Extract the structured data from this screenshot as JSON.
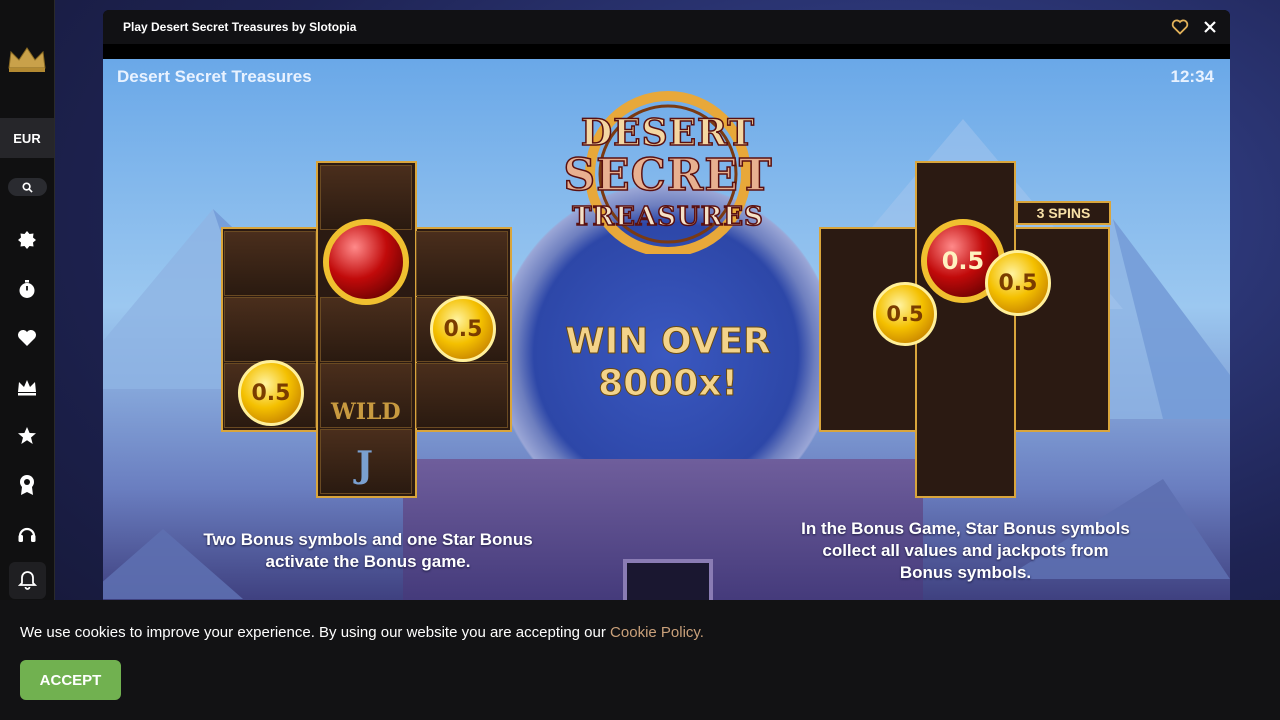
{
  "sidebar": {
    "logo_icon": "crown-logo-icon",
    "currency": "EUR",
    "icons": [
      "search-icon",
      "new-badge-icon",
      "stopwatch-icon",
      "heart-icon",
      "crown-icon",
      "star-icon",
      "award-icon",
      "headset-icon",
      "bell-icon"
    ]
  },
  "window": {
    "title": "Play Desert Secret Treasures by Slotopia"
  },
  "game": {
    "hud_title": "Desert Secret Treasures",
    "clock": "12:34",
    "logo_lines": [
      "DESERT",
      "SECRET",
      "TREASURES"
    ],
    "win_line1": "WIN OVER",
    "win_line2": "8000x!",
    "coin_value": "0.5",
    "wild_label": "WILD",
    "j_label": "J",
    "spins_badge": "3 SPINS",
    "left_desc_line1": "Two Bonus symbols and one Star Bonus",
    "left_desc_line2": "activate the Bonus game.",
    "right_desc_line1": "In the Bonus Game, Star Bonus symbols",
    "right_desc_line2": "collect all values and jackpots from",
    "right_desc_line3": "Bonus symbols."
  },
  "cookie": {
    "text": "We use cookies to improve your experience. By using our website you are accepting our ",
    "link": "Cookie Policy.",
    "accept": "ACCEPT"
  },
  "colors": {
    "accent_green": "#71b150",
    "link_tan": "#c9a07a",
    "gold": "#d9a53c"
  }
}
